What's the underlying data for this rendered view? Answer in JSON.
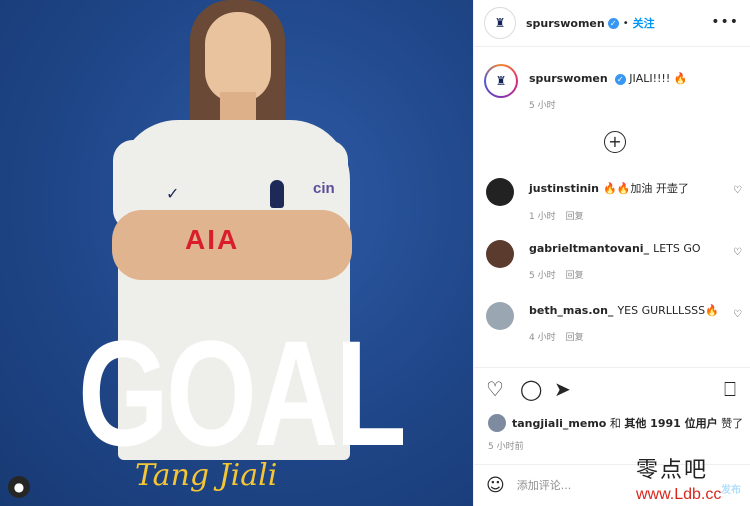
{
  "post": {
    "image_text": "GOAL",
    "signature": "Tang Jiali",
    "sponsor": "AIA",
    "shirt_text": "cin"
  },
  "header": {
    "username": "spurswomen",
    "separator": "•",
    "follow_label": "关注",
    "more_label": "•••"
  },
  "caption": {
    "username": "spurswomen",
    "text": "JIALI!!!! 🔥",
    "time": "5 小时"
  },
  "load_more_icon": "plus-circle-icon",
  "comments": [
    {
      "username": "justinstinin",
      "text": "🔥🔥加油 开壶了",
      "time": "1 小时",
      "reply": "回复",
      "avatar_color": "#222222"
    },
    {
      "username": "gabrieltmantovani_",
      "text": "LETS GO",
      "time": "5 小时",
      "reply": "回复",
      "avatar_color": "#5a3b2e"
    },
    {
      "username": "beth_mas.on_",
      "text": "YES GURLLLSSS🔥",
      "time": "4 小时",
      "reply": "回复",
      "avatar_color": "#9aa7b3"
    }
  ],
  "likes": {
    "user": "tangjiali_memo",
    "and": "和",
    "others": "其他 1991 位用户",
    "liked": "赞了"
  },
  "post_time": "5 小时前",
  "comment_input": {
    "placeholder": "添加评论...",
    "post_label": "发布"
  },
  "watermark": {
    "line1": "零点吧",
    "line2": "www.Ldb.cc"
  },
  "colors": {
    "brand_blue": "#0095f6",
    "verified": "#3897f0",
    "post_bg": "#1f4688"
  }
}
